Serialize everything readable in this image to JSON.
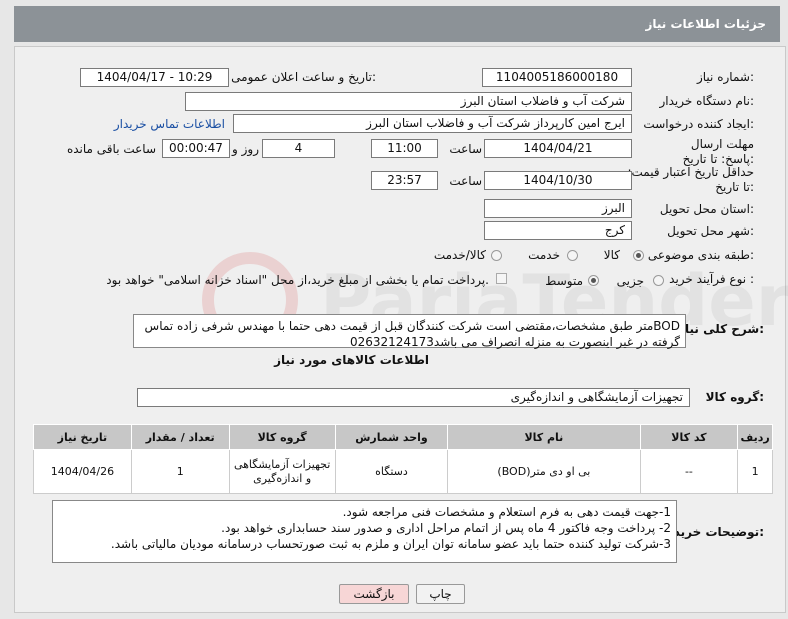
{
  "header": {
    "title": "جزئیات اطلاعات نیاز"
  },
  "fields": {
    "need_number_label": "شماره نیاز:",
    "need_number": "1104005186000180",
    "announce_label": "تاریخ و ساعت اعلان عمومی:",
    "announce_value": "1404/04/17 - 10:29",
    "buyer_org_label": "نام دستگاه خریدار:",
    "buyer_org": "شرکت آب و فاضلاب استان البرز",
    "requester_label": "ایجاد کننده درخواست:",
    "requester": "ایرج امین کارپرداز شرکت آب و فاضلاب استان البرز",
    "buyer_contact_link": "اطلاعات تماس خریدار",
    "deadline_label": "مهلت ارسال پاسخ: تا تاریخ:",
    "deadline_date": "1404/04/21",
    "time_label": "ساعت",
    "deadline_time": "11:00",
    "days": "4",
    "days_label": "روز و",
    "remaining": "00:00:47",
    "remaining_label": "ساعت باقی مانده",
    "validity_label": "حداقل تاریخ اعتبار قیمت: تا تاریخ:",
    "validity_date": "1404/10/30",
    "validity_time": "23:57",
    "province_label": "استان محل تحویل:",
    "province": "البرز",
    "city_label": "شهر محل تحویل:",
    "city": "کرج",
    "category_label": "طبقه بندی موضوعی:",
    "category_options": [
      "کالا",
      "خدمت",
      "کالا/خدمت"
    ],
    "purchase_type_label": "نوع فرآیند خرید :",
    "purchase_options": [
      "جزیی",
      "متوسط"
    ],
    "payment_note": "پرداخت تمام یا بخشی از مبلغ خرید،از محل \"اسناد خزانه اسلامی\" خواهد بود."
  },
  "description": {
    "label": "شرح کلی نیاز:",
    "text": "BODمتر طبق مشخصات،مقتضی است شرکت کنندگان قبل از قیمت دهی حتما با مهندس شرفی زاده تماس گرفته در غیر اینصورت به منزله انصراف می باشد02632124173"
  },
  "goods": {
    "section_title": "اطلاعات کالاهای مورد نیاز",
    "group_label": "گروه کالا:",
    "group_value": "تجهیزات آزمایشگاهی و اندازه‌گیری",
    "columns": [
      "ردیف",
      "کد کالا",
      "نام کالا",
      "واحد شمارش",
      "گروه کالا",
      "تعداد / مقدار",
      "تاریخ نیاز"
    ],
    "rows": [
      {
        "row": "1",
        "code": "--",
        "name": "بی او دی متر(BOD)",
        "unit": "دستگاه",
        "group": "تجهیزات آزمایشگاهی و اندازه‌گیری",
        "qty": "1",
        "date": "1404/04/26"
      }
    ]
  },
  "buyer_notes": {
    "label": "توضیحات خریدار:",
    "lines": [
      "1-جهت قیمت دهی به فرم استعلام و مشخصات فنی مراجعه شود.",
      "2- پرداخت وجه فاکتور 4 ماه پس از اتمام مراحل اداری و صدور سند حسابداری خواهد بود.",
      "3-شرکت تولید کننده حتما باید عضو سامانه توان ایران و ملزم به ثبت صورتحساب درسامانه مودیان مالیاتی باشد."
    ]
  },
  "buttons": {
    "print": "چاپ",
    "back": "بازگشت"
  },
  "colors": {
    "header_bg": "#8c9297",
    "link": "#1a4fa3",
    "back_button_bg": "#f7d6d6"
  }
}
